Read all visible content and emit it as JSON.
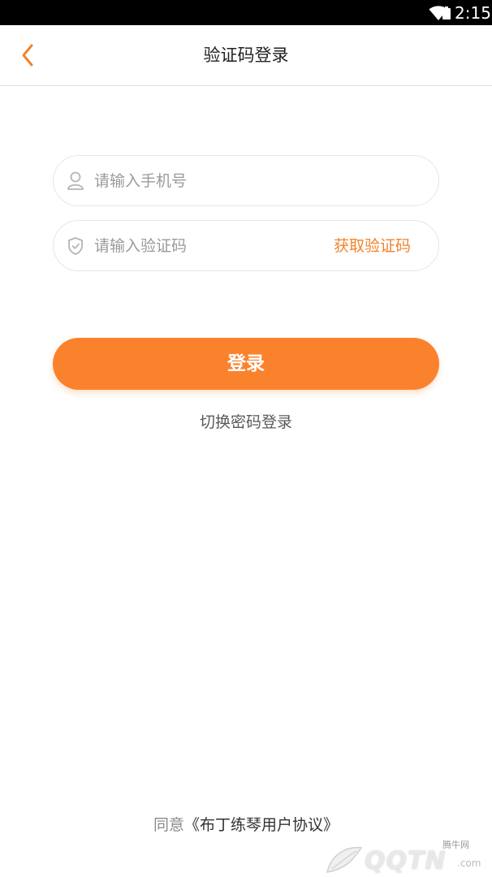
{
  "status_bar": {
    "time": "2:15"
  },
  "nav": {
    "title": "验证码登录"
  },
  "form": {
    "phone_placeholder": "请输入手机号",
    "code_placeholder": "请输入验证码",
    "get_code_label": "获取验证码"
  },
  "login_button": {
    "label": "登录"
  },
  "switch_link": {
    "label": "切换密码登录"
  },
  "agreement": {
    "prefix": "同意",
    "link": "《布丁练琴用户协议》"
  },
  "watermark": {
    "cn": "腾牛网",
    "logo": "QQTN",
    "dotcom": ".com"
  },
  "colors": {
    "accent": "#fb822c",
    "accent_text": "#f2832b"
  }
}
